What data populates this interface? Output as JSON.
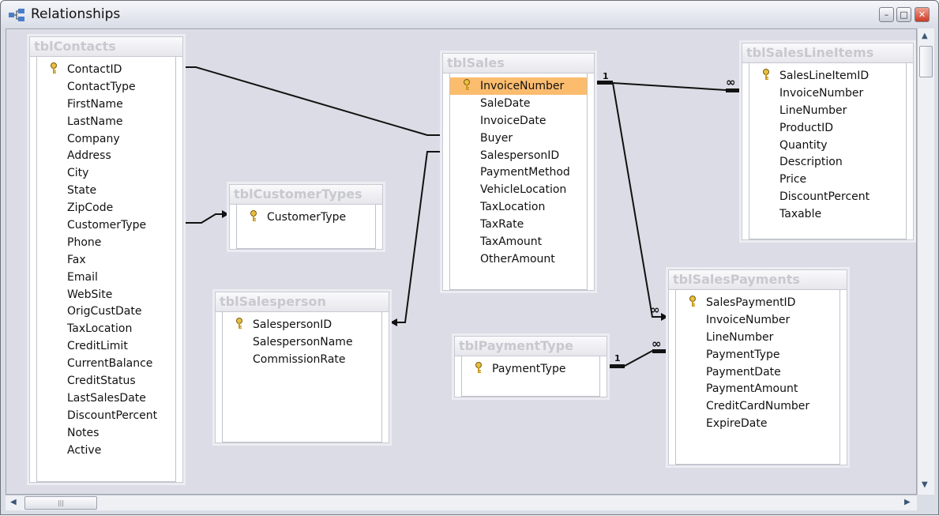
{
  "window": {
    "title": "Relationships"
  },
  "tables": [
    {
      "id": "tblContacts",
      "title": "tblContacts",
      "key": "ContactID",
      "fields": [
        "ContactID",
        "ContactType",
        "FirstName",
        "LastName",
        "Company",
        "Address",
        "City",
        "State",
        "ZipCode",
        "CustomerType",
        "Phone",
        "Fax",
        "Email",
        "WebSite",
        "OrigCustDate",
        "TaxLocation",
        "CreditLimit",
        "CurrentBalance",
        "CreditStatus",
        "LastSalesDate",
        "DiscountPercent",
        "Notes",
        "Active"
      ]
    },
    {
      "id": "tblCustomerTypes",
      "title": "tblCustomerTypes",
      "key": "CustomerType",
      "fields": [
        "CustomerType"
      ]
    },
    {
      "id": "tblSalesperson",
      "title": "tblSalesperson",
      "key": "SalespersonID",
      "fields": [
        "SalespersonID",
        "SalespersonName",
        "CommissionRate"
      ]
    },
    {
      "id": "tblSales",
      "title": "tblSales",
      "key": "InvoiceNumber",
      "selected": "InvoiceNumber",
      "fields": [
        "InvoiceNumber",
        "SaleDate",
        "InvoiceDate",
        "Buyer",
        "SalespersonID",
        "PaymentMethod",
        "VehicleLocation",
        "TaxLocation",
        "TaxRate",
        "TaxAmount",
        "OtherAmount"
      ]
    },
    {
      "id": "tblPaymentType",
      "title": "tblPaymentType",
      "key": "PaymentType",
      "fields": [
        "PaymentType"
      ]
    },
    {
      "id": "tblSalesLineItems",
      "title": "tblSalesLineItems",
      "key": "SalesLineItemID",
      "fields": [
        "SalesLineItemID",
        "InvoiceNumber",
        "LineNumber",
        "ProductID",
        "Quantity",
        "Description",
        "Price",
        "DiscountPercent",
        "Taxable"
      ]
    },
    {
      "id": "tblSalesPayments",
      "title": "tblSalesPayments",
      "key": "SalesPaymentID",
      "fields": [
        "SalesPaymentID",
        "InvoiceNumber",
        "LineNumber",
        "PaymentType",
        "PaymentDate",
        "PaymentAmount",
        "CreditCardNumber",
        "ExpireDate"
      ]
    }
  ],
  "relationship_labels": {
    "one": "1",
    "many": "∞"
  },
  "colors": {
    "selected_row": "#fbbc6e",
    "canvas": "#dcdce6"
  }
}
